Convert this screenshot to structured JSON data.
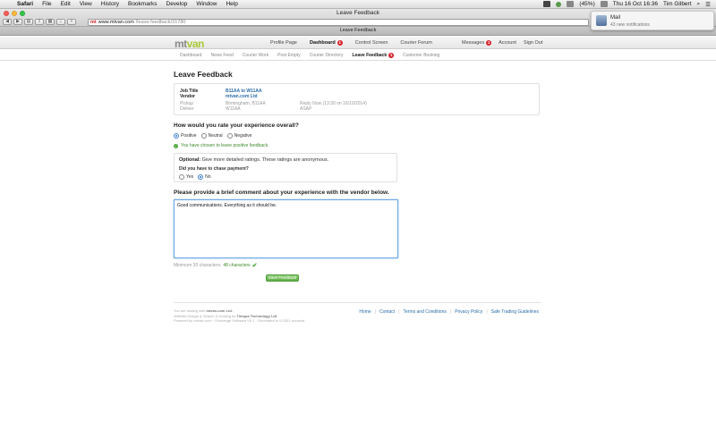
{
  "menubar": {
    "app": "Safari",
    "items": [
      "File",
      "Edit",
      "View",
      "History",
      "Bookmarks",
      "Develop",
      "Window",
      "Help"
    ],
    "battery_status": "(45%)",
    "clock": "Thu 16 Oct  16:36",
    "user": "Tim Gilbert"
  },
  "browser": {
    "window_title": "Leave Feedback",
    "address_host": "www.mtvan.com",
    "address_path": "/leave-feedback/31780",
    "address_prefix": "mt",
    "tab_title": "Leave Feedback"
  },
  "notification": {
    "title": "Mail",
    "subtitle": "43 new notifications"
  },
  "site": {
    "logo_part1": "mt",
    "logo_part2": "van",
    "nav": [
      {
        "label": "Profile Page",
        "badge": ""
      },
      {
        "label": "Dashboard",
        "badge": "1"
      },
      {
        "label": "Control Screen",
        "badge": ""
      },
      {
        "label": "Courier Forum",
        "badge": ""
      }
    ],
    "nav_right": [
      {
        "label": "Messages",
        "badge": "1"
      },
      {
        "label": "Account",
        "badge": ""
      },
      {
        "label": "Sign Out",
        "badge": ""
      }
    ],
    "subnav": [
      {
        "label": "Dashboard",
        "badge": ""
      },
      {
        "label": "News Feed",
        "badge": ""
      },
      {
        "label": "Courier Work",
        "badge": ""
      },
      {
        "label": "Post Empty",
        "badge": ""
      },
      {
        "label": "Courier Directory",
        "badge": ""
      },
      {
        "label": "Leave Feedback",
        "badge": "1"
      },
      {
        "label": "Customer Booking",
        "badge": ""
      }
    ]
  },
  "page": {
    "title": "Leave Feedback",
    "job": {
      "job_title_label": "Job Title",
      "job_title_value": "B11AA to W11AA",
      "vendor_label": "Vendor",
      "vendor_value": "mtvan.com Ltd",
      "pickup_label": "Pickup",
      "pickup_value": "Birmingham, B11AA",
      "deliver_label": "Deliver",
      "deliver_value": "W11AA",
      "reply_text": "Reply Now (13:30 on 16/10/2014)",
      "reply_sub": "ASAP"
    },
    "question1": "How would you rate your experience overall?",
    "ratings": [
      "Positive",
      "Neutral",
      "Negative"
    ],
    "selected_rating": "Positive",
    "confirm_text": "You have chosen to leave positive feedback.",
    "optional_label": "Optional:",
    "optional_text": "Give more detailed ratings. These ratings are anonymous.",
    "chase_question": "Did you have to chase payment?",
    "chase_options": [
      "Yes",
      "No"
    ],
    "chase_selected": "No",
    "question2": "Please provide a brief comment about your experience with the vendor below.",
    "comment": "Good communications. Everything as it should be.",
    "minimum_text": "Minimum 30 characters.",
    "count_text": "48 characters",
    "save_label": "Save Feedback"
  },
  "footer": {
    "line1_prefix": "You are trading with",
    "line1_company": "mtvan.com Ltd.",
    "line2_prefix": "Website Design & Search & Hosting by",
    "line2_company": "Tiniqua Technology Ltd",
    "line3": "Powered by mtvan.com ~ Exchange Software V5.1 · Generated in 0.0301 seconds",
    "links": [
      "Home",
      "Contact",
      "Terms and Conditions",
      "Privacy Policy",
      "Safe Trading Guidelines"
    ]
  }
}
